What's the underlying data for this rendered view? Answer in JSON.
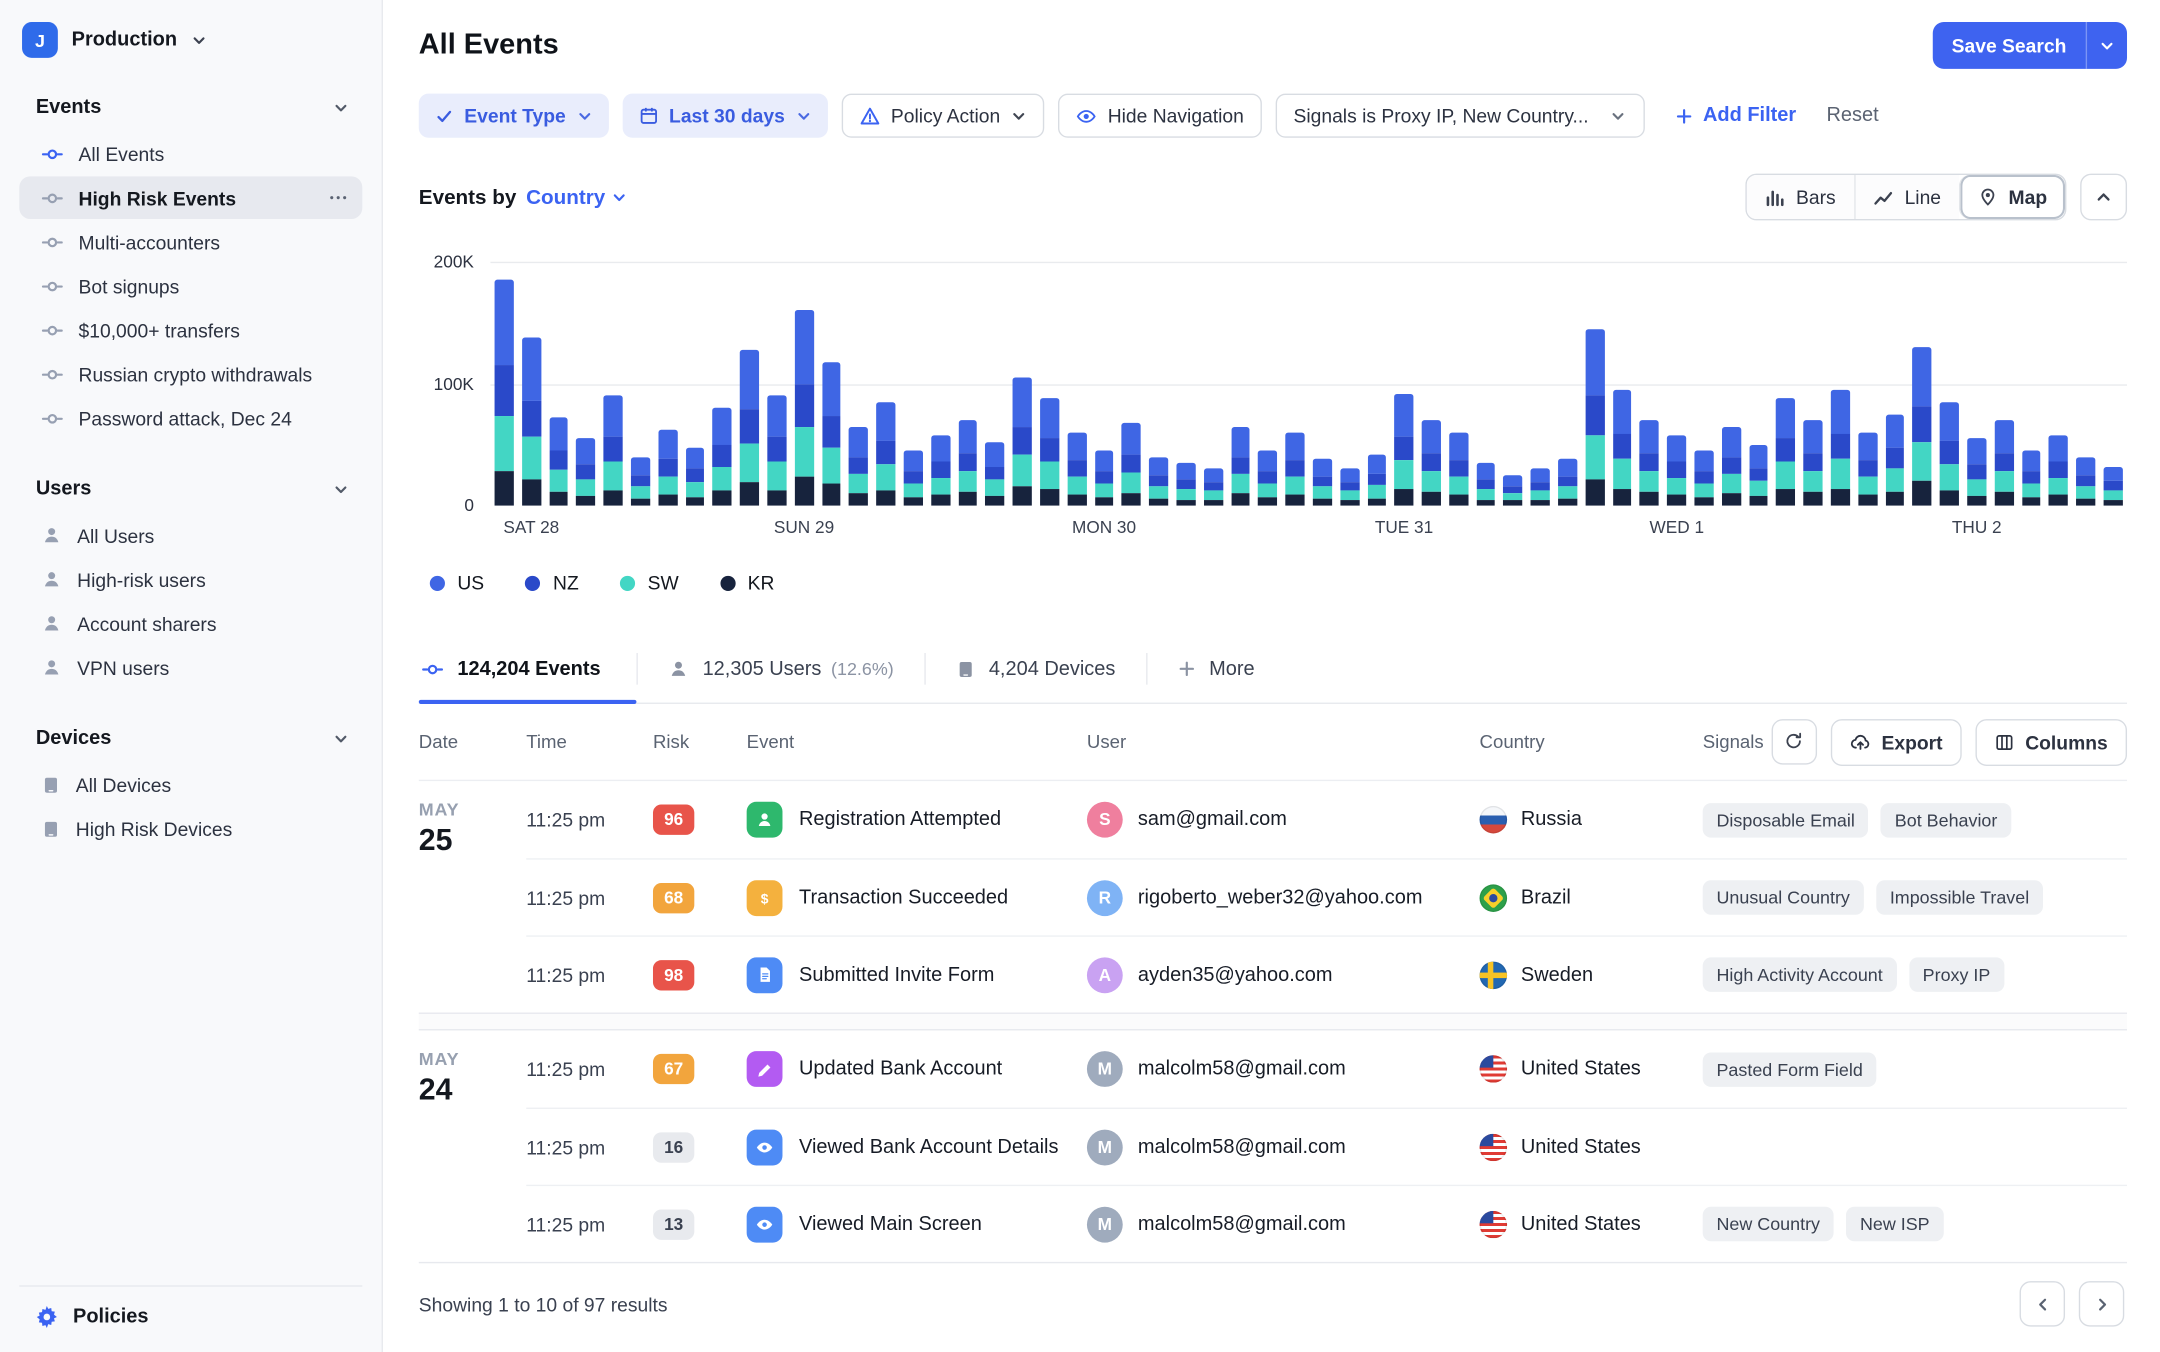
{
  "workspace": {
    "initial": "J",
    "name": "Production"
  },
  "sidebar": {
    "sections": [
      {
        "label": "Events",
        "item_icon": "node",
        "items": [
          {
            "label": "All Events",
            "icon_color": "#3b63f2"
          },
          {
            "label": "High Risk Events",
            "selected": true
          },
          {
            "label": "Multi-accounters"
          },
          {
            "label": "Bot signups"
          },
          {
            "label": "$10,000+ transfers"
          },
          {
            "label": "Russian crypto withdrawals"
          },
          {
            "label": "Password attack, Dec 24"
          }
        ]
      },
      {
        "label": "Users",
        "item_icon": "user",
        "items": [
          {
            "label": "All Users"
          },
          {
            "label": "High-risk users"
          },
          {
            "label": "Account sharers"
          },
          {
            "label": "VPN users"
          }
        ]
      },
      {
        "label": "Devices",
        "item_icon": "tablet",
        "items": [
          {
            "label": "All Devices"
          },
          {
            "label": "High Risk Devices"
          }
        ]
      }
    ],
    "footer_label": "Policies"
  },
  "header": {
    "title": "All Events",
    "save_label": "Save Search"
  },
  "filters": {
    "chips": [
      {
        "label": "Event Type",
        "style": "active",
        "icon": "check",
        "chevron": true
      },
      {
        "label": "Last 30 days",
        "style": "active",
        "icon": "calendar",
        "chevron": true
      },
      {
        "label": "Policy Action",
        "style": "outline",
        "icon": "warning",
        "chevron": true
      },
      {
        "label": "Hide Navigation",
        "style": "outline",
        "icon": "eye",
        "chevron": false
      },
      {
        "label": "Signals is Proxy IP, New Country...",
        "style": "outline",
        "icon": null,
        "chevron": true,
        "wide": true
      }
    ],
    "add_label": "Add Filter",
    "reset_label": "Reset"
  },
  "chart": {
    "title_prefix": "Events by",
    "dimension": "Country",
    "views": [
      {
        "label": "Bars",
        "icon": "bars"
      },
      {
        "label": "Line",
        "icon": "line"
      },
      {
        "label": "Map",
        "icon": "pin"
      }
    ],
    "selected_view": "Map"
  },
  "chart_data": {
    "type": "bar",
    "stacked": true,
    "unit": "thousands of events",
    "ymax": 200,
    "y_ticks": [
      "200K",
      "100K",
      "0"
    ],
    "series": [
      {
        "name": "US",
        "color": "#3f66e4"
      },
      {
        "name": "NZ",
        "color": "#2a49c9"
      },
      {
        "name": "SW",
        "color": "#43d6c4"
      },
      {
        "name": "KR",
        "color": "#17233d"
      }
    ],
    "x_labels": [
      {
        "i": 1,
        "label": "SAT 28"
      },
      {
        "i": 11,
        "label": "SUN 29"
      },
      {
        "i": 22,
        "label": "MON 30"
      },
      {
        "i": 33,
        "label": "TUE 31"
      },
      {
        "i": 43,
        "label": "WED 1"
      },
      {
        "i": 54,
        "label": "THU 2"
      }
    ],
    "bars": [
      [
        70,
        41,
        46,
        28
      ],
      [
        52,
        30,
        35,
        21
      ],
      [
        27,
        16,
        18,
        11
      ],
      [
        21,
        12,
        14,
        8
      ],
      [
        34,
        20,
        23,
        13
      ],
      [
        15,
        9,
        10,
        6
      ],
      [
        24,
        14,
        15,
        9
      ],
      [
        18,
        11,
        12,
        7
      ],
      [
        30,
        18,
        20,
        12
      ],
      [
        49,
        28,
        32,
        19
      ],
      [
        34,
        20,
        23,
        13
      ],
      [
        61,
        35,
        40,
        24
      ],
      [
        45,
        26,
        29,
        18
      ],
      [
        25,
        14,
        16,
        10
      ],
      [
        32,
        19,
        21,
        13
      ],
      [
        17,
        10,
        11,
        7
      ],
      [
        22,
        13,
        14,
        9
      ],
      [
        27,
        15,
        17,
        11
      ],
      [
        20,
        11,
        13,
        8
      ],
      [
        40,
        23,
        26,
        16
      ],
      [
        33,
        19,
        22,
        14
      ],
      [
        23,
        13,
        15,
        9
      ],
      [
        17,
        10,
        11,
        7
      ],
      [
        26,
        15,
        17,
        10
      ],
      [
        15,
        9,
        10,
        6
      ],
      [
        13,
        8,
        9,
        5
      ],
      [
        11,
        7,
        7,
        5
      ],
      [
        25,
        14,
        16,
        10
      ],
      [
        17,
        10,
        11,
        7
      ],
      [
        23,
        13,
        15,
        9
      ],
      [
        14,
        8,
        10,
        6
      ],
      [
        11,
        7,
        7,
        5
      ],
      [
        16,
        9,
        11,
        6
      ],
      [
        35,
        20,
        23,
        14
      ],
      [
        27,
        15,
        17,
        11
      ],
      [
        23,
        13,
        15,
        9
      ],
      [
        13,
        8,
        9,
        5
      ],
      [
        9,
        6,
        6,
        4
      ],
      [
        11,
        7,
        7,
        5
      ],
      [
        14,
        8,
        10,
        6
      ],
      [
        55,
        32,
        36,
        22
      ],
      [
        36,
        21,
        24,
        14
      ],
      [
        27,
        15,
        17,
        11
      ],
      [
        22,
        13,
        14,
        9
      ],
      [
        17,
        10,
        11,
        7
      ],
      [
        25,
        14,
        16,
        10
      ],
      [
        19,
        11,
        12,
        8
      ],
      [
        33,
        19,
        22,
        14
      ],
      [
        27,
        15,
        17,
        11
      ],
      [
        36,
        21,
        24,
        14
      ],
      [
        23,
        13,
        15,
        9
      ],
      [
        28,
        17,
        19,
        11
      ],
      [
        49,
        29,
        32,
        20
      ],
      [
        32,
        19,
        21,
        13
      ],
      [
        21,
        12,
        14,
        8
      ],
      [
        27,
        15,
        17,
        11
      ],
      [
        17,
        10,
        11,
        7
      ],
      [
        22,
        13,
        14,
        9
      ],
      [
        15,
        9,
        10,
        6
      ],
      [
        12,
        7,
        8,
        5
      ]
    ]
  },
  "tabs": [
    {
      "label": "124,204 Events",
      "icon": "node",
      "active": true
    },
    {
      "label": "12,305 Users",
      "suffix": "(12.6%)",
      "icon": "user"
    },
    {
      "label": "4,204 Devices",
      "icon": "tablet"
    },
    {
      "label": "More",
      "icon": "plus"
    }
  ],
  "table": {
    "columns": [
      "Date",
      "Time",
      "Risk",
      "Event",
      "User",
      "Country",
      "Signals"
    ],
    "actions": {
      "export_label": "Export",
      "columns_label": "Columns"
    },
    "groups": [
      {
        "month": "MAY",
        "day": "25",
        "rows": [
          {
            "time": "11:25 pm",
            "risk": "96",
            "risk_style": "high",
            "event": "Registration Attempted",
            "event_icon": "user-add",
            "event_color": "#2eb86d",
            "user_initial": "S",
            "avatar_color": "#ef7f9e",
            "user_email": "sam@gmail.com",
            "country": "Russia",
            "flag": "ru",
            "signals": [
              "Disposable Email",
              "Bot Behavior"
            ]
          },
          {
            "time": "11:25 pm",
            "risk": "68",
            "risk_style": "med",
            "event": "Transaction Succeeded",
            "event_icon": "dollar",
            "event_color": "#f4b13e",
            "user_initial": "R",
            "avatar_color": "#7fb3f5",
            "user_email": "rigoberto_weber32@yahoo.com",
            "country": "Brazil",
            "flag": "br",
            "signals": [
              "Unusual Country",
              "Impossible Travel"
            ]
          },
          {
            "time": "11:25 pm",
            "risk": "98",
            "risk_style": "high",
            "event": "Submitted Invite Form",
            "event_icon": "form",
            "event_color": "#4e8bf5",
            "user_initial": "A",
            "avatar_color": "#c9a2f2",
            "user_email": "ayden35@yahoo.com",
            "country": "Sweden",
            "flag": "se",
            "signals": [
              "High Activity Account",
              "Proxy IP"
            ]
          }
        ]
      },
      {
        "month": "MAY",
        "day": "24",
        "rows": [
          {
            "time": "11:25 pm",
            "risk": "67",
            "risk_style": "med",
            "event": "Updated Bank Account",
            "event_icon": "pencil",
            "event_color": "#b35bf2",
            "user_initial": "M",
            "avatar_color": "#9fabbd",
            "user_email": "malcolm58@gmail.com",
            "country": "United States",
            "flag": "us",
            "signals": [
              "Pasted Form Field"
            ]
          },
          {
            "time": "11:25 pm",
            "risk": "16",
            "risk_style": "low",
            "event": "Viewed Bank Account Details",
            "event_icon": "eye",
            "event_color": "#4e8bf5",
            "user_initial": "M",
            "avatar_color": "#9fabbd",
            "user_email": "malcolm58@gmail.com",
            "country": "United States",
            "flag": "us",
            "signals": []
          },
          {
            "time": "11:25 pm",
            "risk": "13",
            "risk_style": "low",
            "event": "Viewed Main Screen",
            "event_icon": "eye",
            "event_color": "#4e8bf5",
            "user_initial": "M",
            "avatar_color": "#9fabbd",
            "user_email": "malcolm58@gmail.com",
            "country": "United States",
            "flag": "us",
            "signals": [
              "New Country",
              "New ISP"
            ]
          }
        ]
      }
    ],
    "footer_summary": "Showing 1 to 10 of 97 results"
  }
}
